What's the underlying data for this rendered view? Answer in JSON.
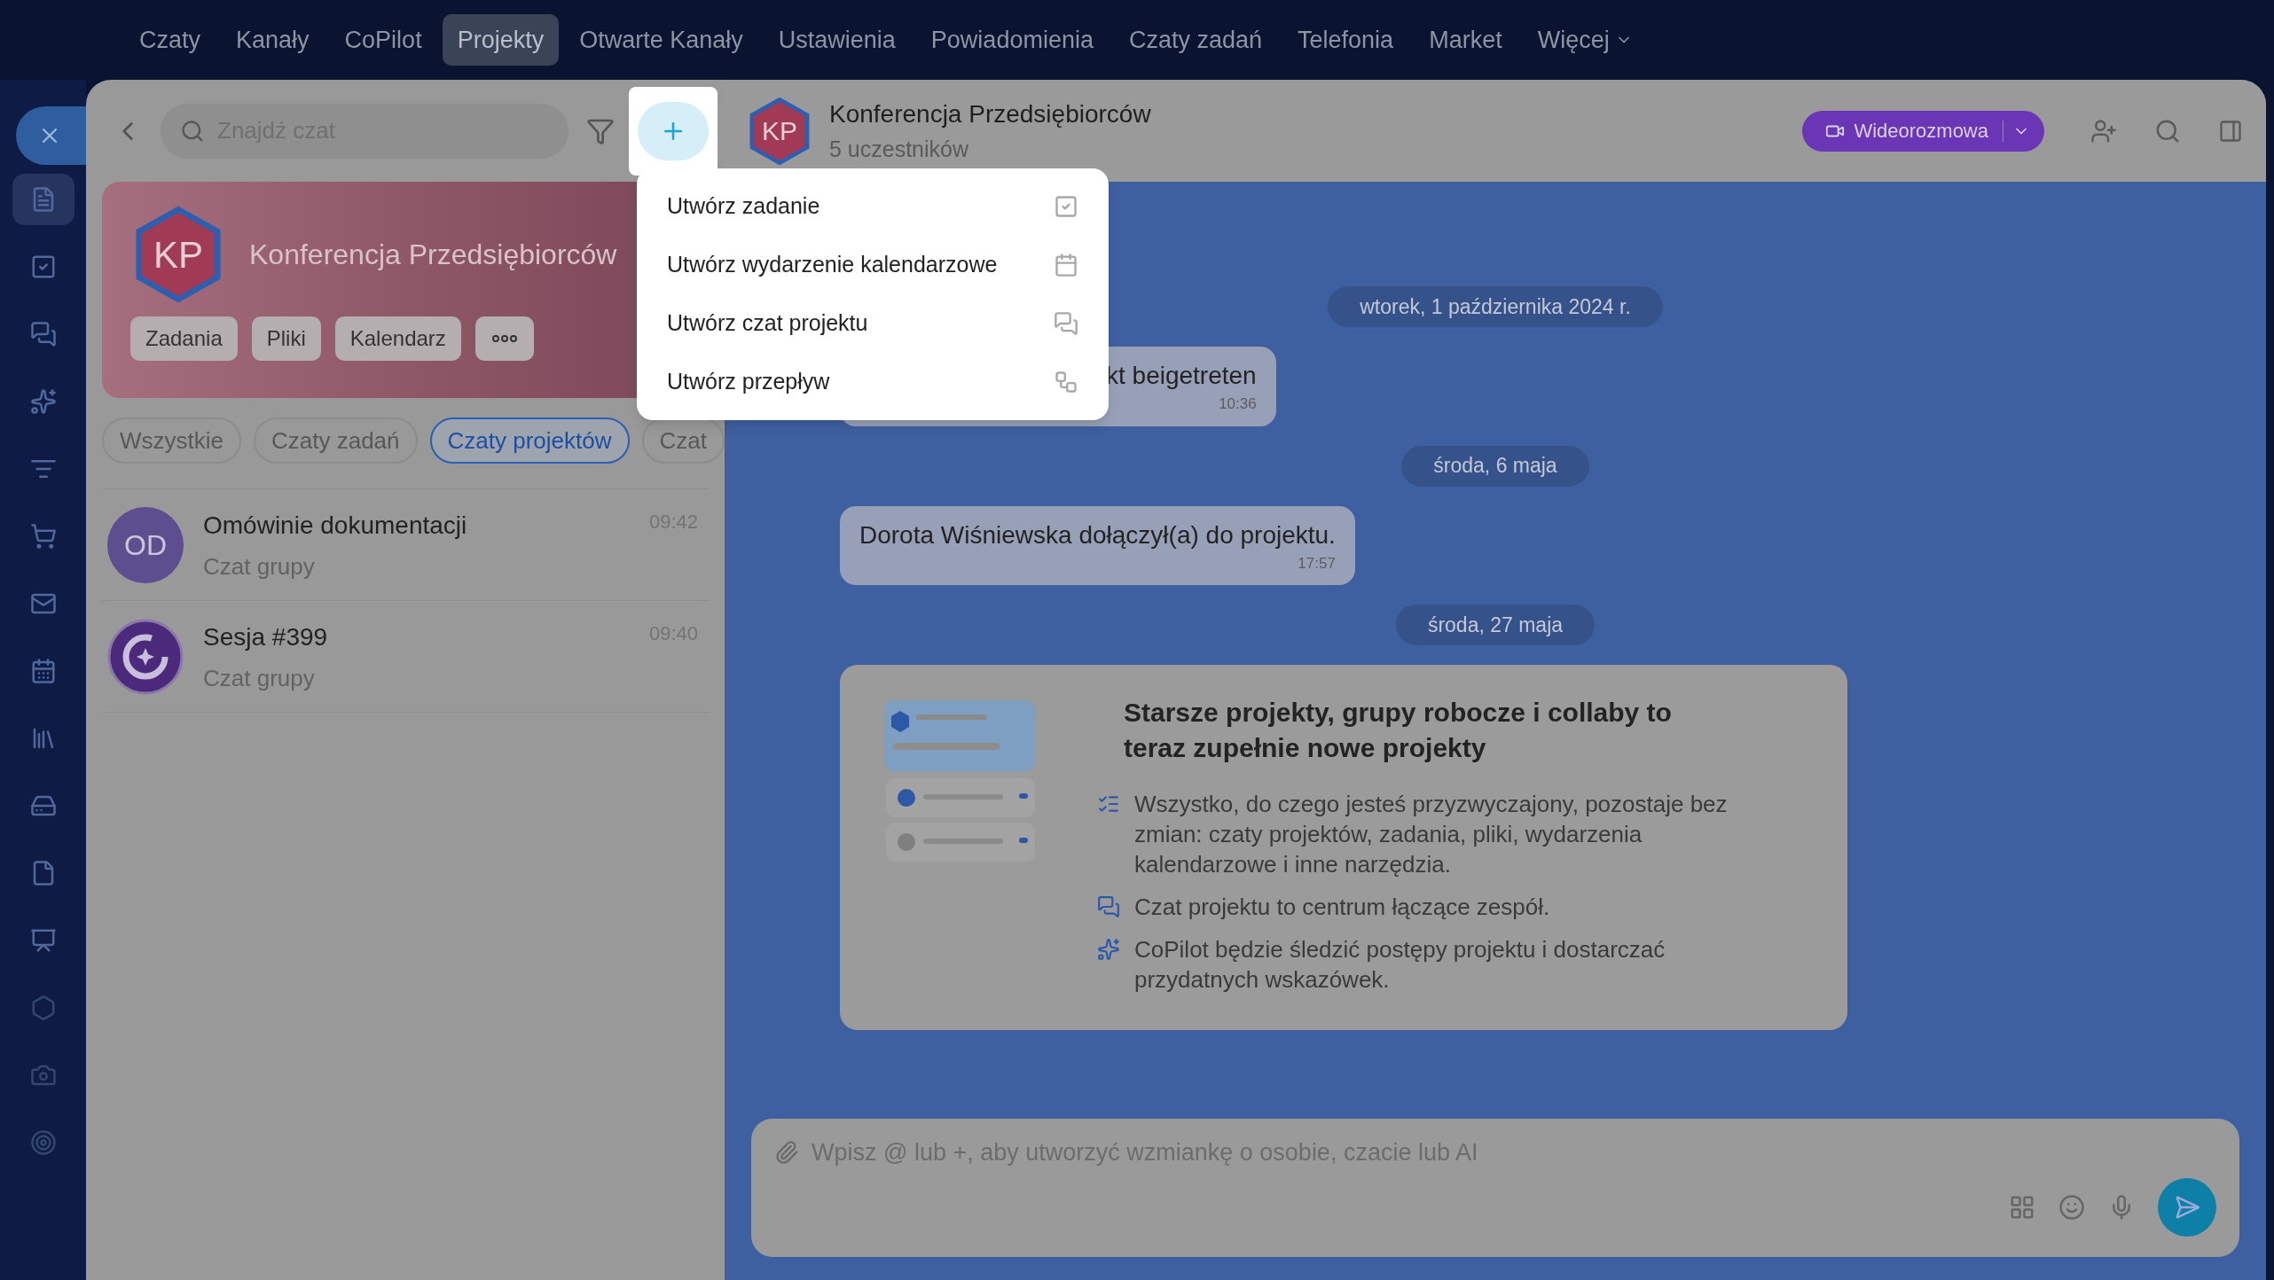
{
  "top_nav": {
    "items": [
      {
        "label": "Czaty",
        "selected": false,
        "has_menu": false
      },
      {
        "label": "Kanały",
        "selected": false,
        "has_menu": false
      },
      {
        "label": "CoPilot",
        "selected": false,
        "has_menu": false
      },
      {
        "label": "Projekty",
        "selected": true,
        "has_menu": false
      },
      {
        "label": "Otwarte Kanały",
        "selected": false,
        "has_menu": false
      },
      {
        "label": "Ustawienia",
        "selected": false,
        "has_menu": false
      },
      {
        "label": "Powiadomienia",
        "selected": false,
        "has_menu": false
      },
      {
        "label": "Czaty zadań",
        "selected": false,
        "has_menu": false
      },
      {
        "label": "Telefonia",
        "selected": false,
        "has_menu": false
      },
      {
        "label": "Market",
        "selected": false,
        "has_menu": false
      },
      {
        "label": "Więcej",
        "selected": false,
        "has_menu": true
      }
    ]
  },
  "left_panel": {
    "search": {
      "placeholder": "Znajdź czat"
    },
    "add_menu": {
      "open": true,
      "items": [
        {
          "label": "Utwórz zadanie"
        },
        {
          "label": "Utwórz wydarzenie kalendarzowe"
        },
        {
          "label": "Utwórz czat projektu"
        },
        {
          "label": "Utwórz przepływ"
        }
      ]
    },
    "project_card": {
      "initials": "KP",
      "name": "Konferencja Przedsiębiorców",
      "buttons": [
        "Zadania",
        "Pliki",
        "Kalendarz"
      ]
    },
    "filters": [
      {
        "label": "Wszystkie",
        "selected": false
      },
      {
        "label": "Czaty zadań",
        "selected": false
      },
      {
        "label": "Czaty projektów",
        "selected": true
      },
      {
        "label": "Czat",
        "selected": false
      }
    ],
    "chats": [
      {
        "kind": "initials",
        "initials": "OD",
        "title": "Omówinie dokumentacji",
        "subtitle": "Czat grupy",
        "time": "09:42"
      },
      {
        "kind": "logo",
        "title": "Sesja #399",
        "subtitle": "Czat grupy",
        "time": "09:40"
      }
    ]
  },
  "chat": {
    "initials": "KP",
    "title": "Konferencja Przedsiębiorców",
    "subtitle": "5 uczestników",
    "video_button": "Wideorozmowa",
    "messages": [
      {
        "kind": "date",
        "text": "wtorek, 1 października 2024 r."
      },
      {
        "kind": "system",
        "text": "kt beigetreten",
        "time": "10:36"
      },
      {
        "kind": "date",
        "text": "środa, 6 maja"
      },
      {
        "kind": "system",
        "text": "Dorota Wiśniewska dołączył(a) do projektu.",
        "time": "17:57"
      },
      {
        "kind": "date",
        "text": "środa, 27 maja"
      },
      {
        "kind": "card",
        "title": "Starsze projekty, grupy robocze i collaby to teraz zupełnie nowe projekty",
        "bullets": [
          "Wszystko, do czego jesteś przyzwyczajony, pozostaje bez zmian: czaty projektów, zadania, pliki, wydarzenia kalendarzowe i inne narzędzia.",
          "Czat projektu to centrum łączące zespół.",
          "CoPilot będzie śledzić postępy projektu i dostarczać przydatnych wskazówek."
        ]
      }
    ],
    "composer": {
      "placeholder": "Wpisz @ lub +, aby utworzyć wzmiankę o osobie, czacie lub AI"
    }
  }
}
